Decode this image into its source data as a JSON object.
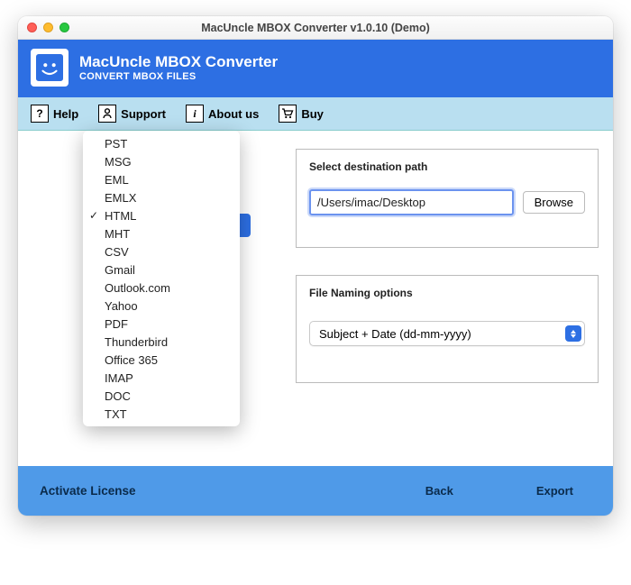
{
  "window": {
    "title": "MacUncle MBOX Converter v1.0.10 (Demo)"
  },
  "brand": {
    "title": "MacUncle MBOX Converter",
    "subtitle": "CONVERT MBOX FILES"
  },
  "toolbar": {
    "help": "Help",
    "support": "Support",
    "about": "About us",
    "buy": "Buy"
  },
  "dropdown": {
    "selected_index": 4,
    "items": [
      "PST",
      "MSG",
      "EML",
      "EMLX",
      "HTML",
      "MHT",
      "CSV",
      "Gmail",
      "Outlook.com",
      "Yahoo",
      "PDF",
      "Thunderbird",
      "Office 365",
      "IMAP",
      "DOC",
      "TXT"
    ]
  },
  "destination": {
    "title": "Select destination path",
    "path": "/Users/imac/Desktop",
    "browse": "Browse"
  },
  "naming": {
    "title": "File Naming options",
    "selected": "Subject + Date (dd-mm-yyyy)"
  },
  "footer": {
    "activate": "Activate License",
    "back": "Back",
    "export": "Export"
  }
}
